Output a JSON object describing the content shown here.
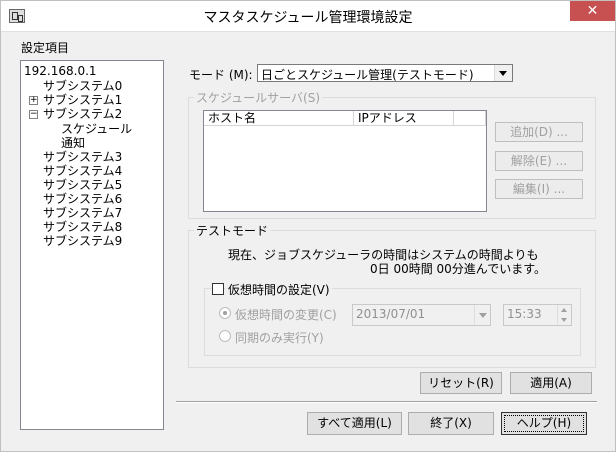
{
  "window": {
    "title": "マスタスケジュール管理環境設定",
    "close": "✕"
  },
  "left": {
    "section_label": "設定項目",
    "tree": [
      {
        "label": "192.168.0.1"
      },
      {
        "label": "サブシステム0"
      },
      {
        "label": "サブシステム1",
        "expander": "+"
      },
      {
        "label": "サブシステム2",
        "expander": "−"
      },
      {
        "label": "スケジュール"
      },
      {
        "label": "通知"
      },
      {
        "label": "サブシステム3"
      },
      {
        "label": "サブシステム4"
      },
      {
        "label": "サブシステム5"
      },
      {
        "label": "サブシステム6"
      },
      {
        "label": "サブシステム7"
      },
      {
        "label": "サブシステム8"
      },
      {
        "label": "サブシステム9"
      }
    ]
  },
  "mode": {
    "label": "モード (M):",
    "selected": "日ごとスケジュール管理(テストモード)"
  },
  "server_group": {
    "title": "スケジュールサーバ(S)",
    "columns": [
      "ホスト名",
      "IPアドレス",
      ""
    ],
    "add": "追加(D) ...",
    "remove": "解除(E) ...",
    "edit": "編集(I) ..."
  },
  "test_mode": {
    "title": "テストモード",
    "line1": "現在、ジョブスケジューラの時間はシステムの時間よりも",
    "line2": "0日  00時間  00分進んでいます。",
    "virtual": {
      "label": "仮想時間の設定(V)",
      "change_label": "仮想時間の変更(C)",
      "date": "2013/07/01",
      "time": "15:33",
      "sync_label": "同期のみ実行(Y)"
    }
  },
  "buttons": {
    "reset": "リセット(R)",
    "apply": "適用(A)",
    "apply_all": "すべて適用(L)",
    "exit": "終了(X)",
    "help": "ヘルプ(H)"
  }
}
